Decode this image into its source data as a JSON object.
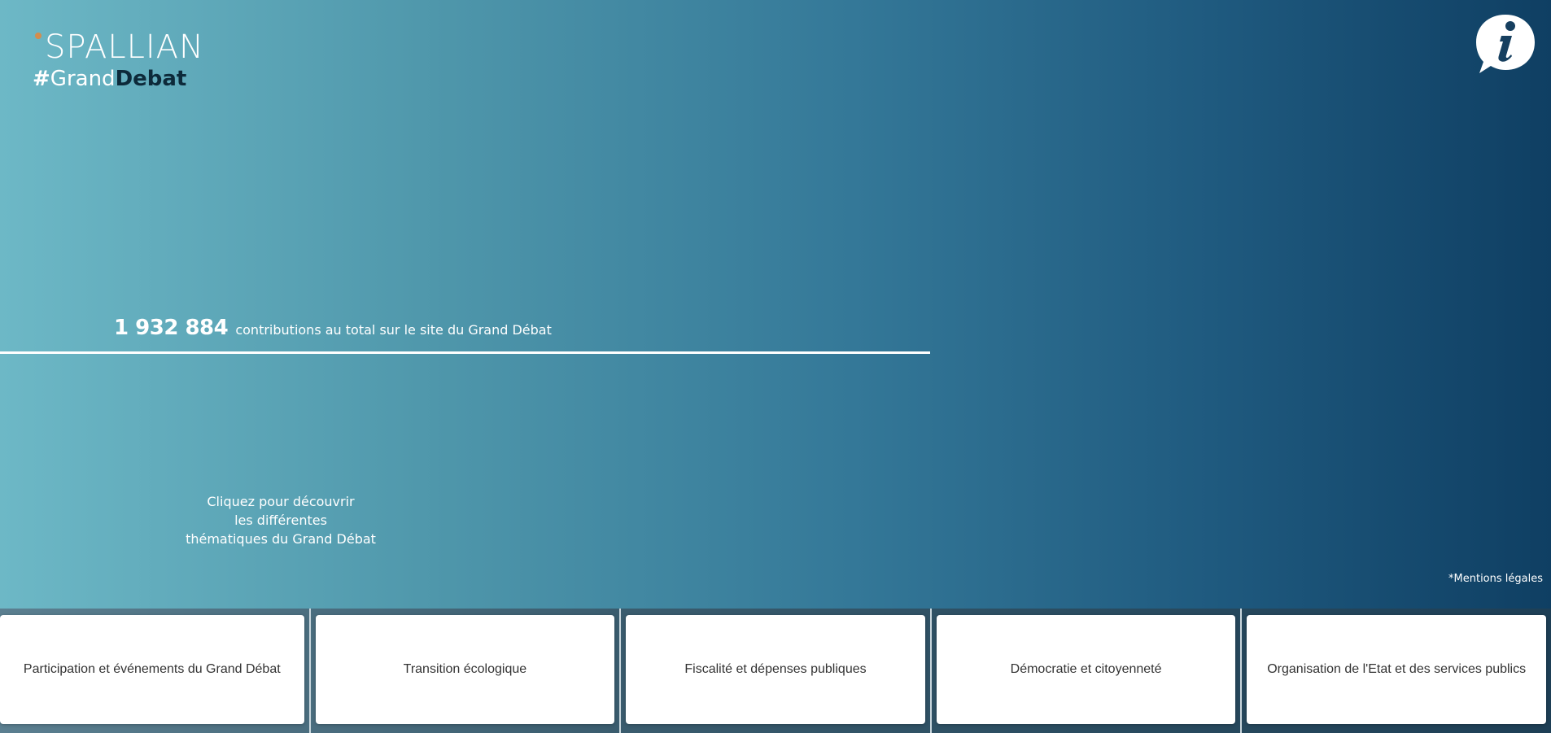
{
  "brand": {
    "name": "SPALLIAN",
    "hashtag": "#",
    "tag_part1": "Grand",
    "tag_part2": "Debat",
    "accent_color": "#d38d4e"
  },
  "info_button": {
    "icon": "info-speech-bubble-icon"
  },
  "stats": {
    "count": "1 932 884",
    "label": "contributions au total sur le site du Grand Débat"
  },
  "explore": {
    "line1": "Cliquez pour découvrir",
    "line2": "les différentes",
    "line3": "thématiques  du Grand Débat"
  },
  "legal": {
    "label": "*Mentions légales"
  },
  "themes": [
    {
      "label": "Participation et événements du Grand Débat"
    },
    {
      "label": "Transition écologique"
    },
    {
      "label": "Fiscalité et dépenses publiques"
    },
    {
      "label": "Démocratie et citoyenneté"
    },
    {
      "label": "Organisation de l'Etat et des services publics"
    }
  ]
}
